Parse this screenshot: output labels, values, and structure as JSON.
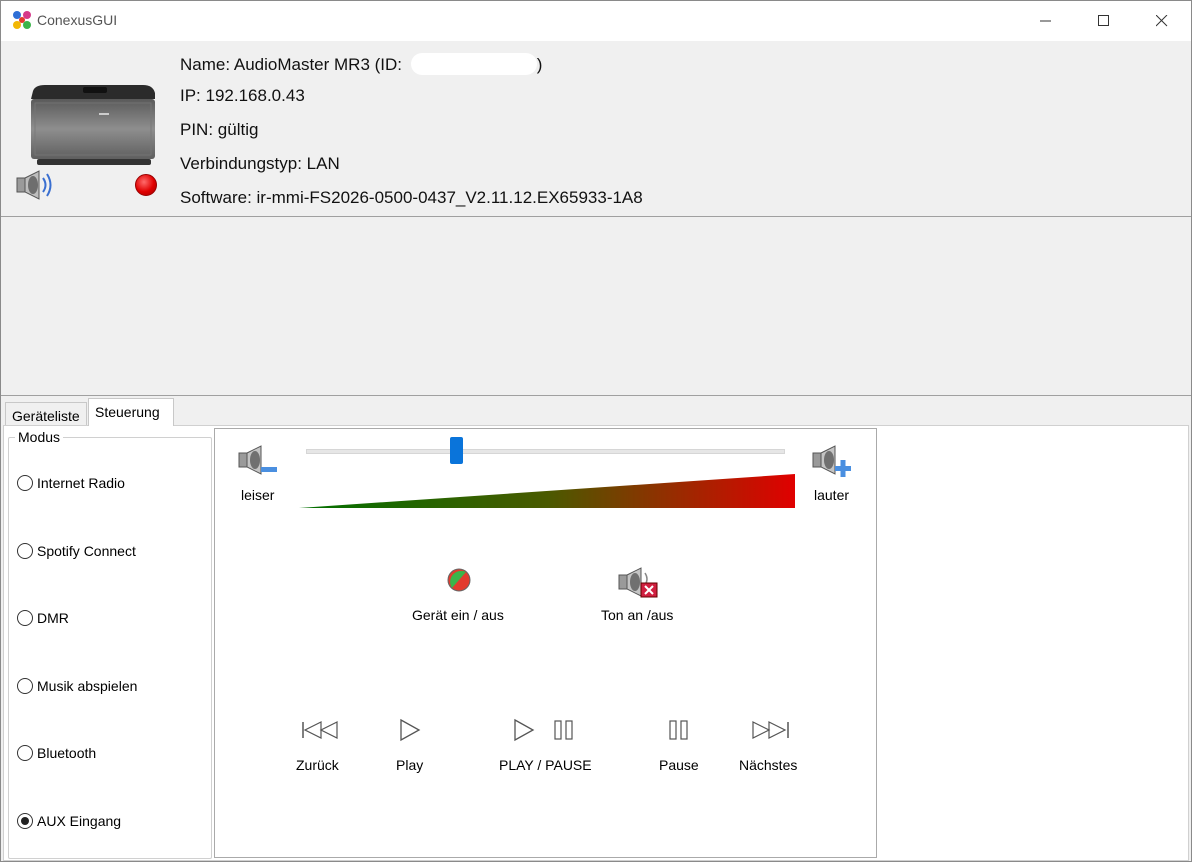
{
  "window": {
    "title": "ConexusGUI",
    "controls": [
      "minimize",
      "maximize",
      "close"
    ]
  },
  "device": {
    "name_prefix": "Name: AudioMaster MR3 (ID: ",
    "name_suffix": ")",
    "ip": "IP: 192.168.0.43",
    "pin": "PIN: gültig",
    "connection": "Verbindungstyp: LAN",
    "software": "Software: ir-mmi-FS2026-0500-0437_V2.11.12.EX65933-1A8",
    "status_color": "#e00000"
  },
  "tabs": [
    {
      "label": "Geräteliste",
      "active": false
    },
    {
      "label": "Steuerung",
      "active": true
    }
  ],
  "modus": {
    "title": "Modus",
    "options": [
      {
        "label": "Internet Radio",
        "selected": false
      },
      {
        "label": "Spotify Connect",
        "selected": false
      },
      {
        "label": "DMR",
        "selected": false
      },
      {
        "label": "Musik abspielen",
        "selected": false
      },
      {
        "label": "Bluetooth",
        "selected": false
      },
      {
        "label": "AUX Eingang",
        "selected": true
      }
    ]
  },
  "volume": {
    "down_label": "leiser",
    "up_label": "lauter",
    "level": 0.31
  },
  "power": {
    "label": "Gerät ein / aus"
  },
  "mute": {
    "label": "Ton an /aus"
  },
  "transport": {
    "prev": "Zurück",
    "play": "Play",
    "play_pause": "PLAY / PAUSE",
    "pause": "Pause",
    "next": "Nächstes"
  },
  "colors": {
    "accent": "#0a74da",
    "ramp_start": "#007000",
    "ramp_end": "#e00000"
  }
}
